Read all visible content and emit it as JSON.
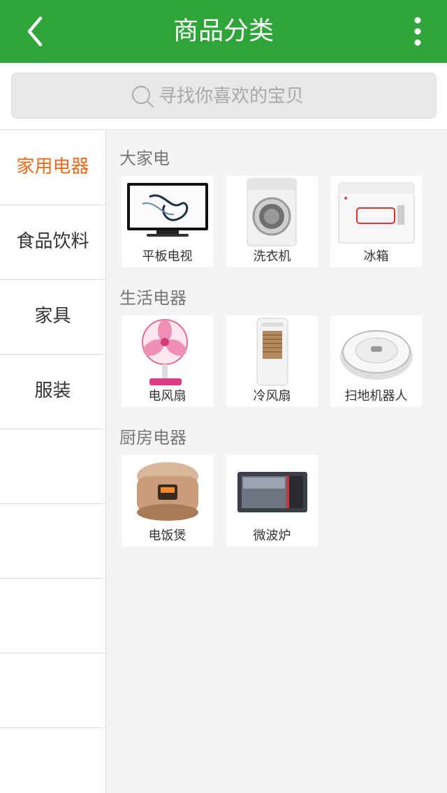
{
  "header": {
    "title": "商品分类",
    "back_icon": "chevron-left-icon",
    "more_icon": "more-vertical-icon"
  },
  "search": {
    "placeholder": "寻找你喜欢的宝贝",
    "icon": "search-icon"
  },
  "sidebar": {
    "items": [
      {
        "label": "家用电器",
        "active": true
      },
      {
        "label": "食品饮料"
      },
      {
        "label": "家具"
      },
      {
        "label": "服装"
      },
      {
        "label": ""
      },
      {
        "label": ""
      },
      {
        "label": ""
      },
      {
        "label": ""
      },
      {
        "label": ""
      }
    ]
  },
  "sections": [
    {
      "title": "大家电",
      "items": [
        {
          "label": "平板电视"
        },
        {
          "label": "洗衣机"
        },
        {
          "label": "冰箱"
        }
      ]
    },
    {
      "title": "生活电器",
      "items": [
        {
          "label": "电风扇"
        },
        {
          "label": "冷风扇"
        },
        {
          "label": "扫地机器人"
        }
      ]
    },
    {
      "title": "厨房电器",
      "items": [
        {
          "label": "电饭煲"
        },
        {
          "label": "微波炉"
        }
      ]
    }
  ],
  "colors": {
    "header_bg": "#2ea43a",
    "active_category": "#ee6a1b"
  }
}
